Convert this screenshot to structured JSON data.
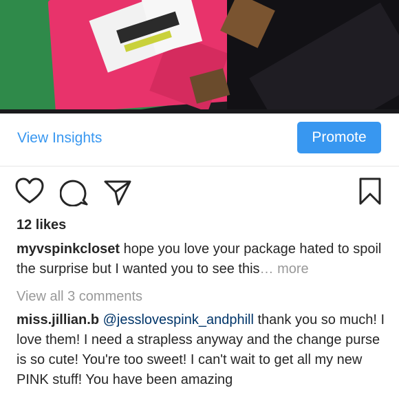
{
  "post": {
    "insights_label": "View Insights",
    "promote_label": "Promote",
    "likes": "12 likes",
    "caption": {
      "username": "myvspinkcloset",
      "text": " hope you love your package hated to spoil the surprise but I wanted you to see this",
      "ellipsis": "…",
      "more_label": " more"
    },
    "view_comments_label": "View all 3 comments",
    "comment": {
      "username": "miss.jillian.b",
      "mention": "@jesslovespink_andphill",
      "text": " thank you so much! I love them! I need a strapless anyway and the change purse is so cute! You're too sweet! I can't wait to get all my new PINK stuff! You have been amazing"
    }
  },
  "icons": {
    "like": "heart-icon",
    "comment": "comment-icon",
    "share": "direct-share-icon",
    "save": "bookmark-icon"
  },
  "colors": {
    "accent": "#3897f0",
    "text": "#262626",
    "muted": "#999999"
  }
}
